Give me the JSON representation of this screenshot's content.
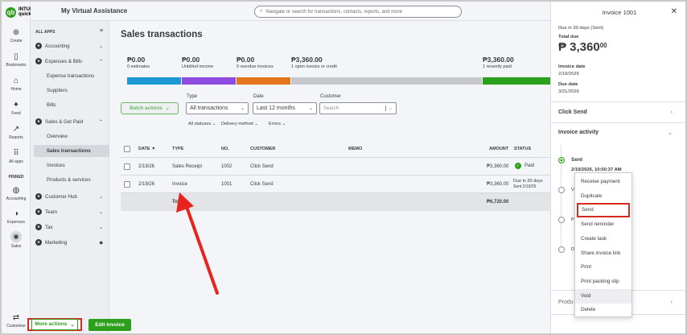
{
  "app": {
    "logo_brand": "INTUIT",
    "logo_name": "quickbooks",
    "company": "My Virtual Assistance"
  },
  "search": {
    "placeholder": "Navigate or search for transactions, contacts, reports, and more"
  },
  "rail": [
    {
      "label": "Create",
      "icon": "plus-icon"
    },
    {
      "label": "Bookmarks",
      "icon": "bookmark-icon"
    },
    {
      "label": "Home",
      "icon": "home-icon"
    },
    {
      "label": "Feed",
      "icon": "feed-icon"
    },
    {
      "label": "Reports",
      "icon": "reports-icon"
    },
    {
      "label": "All apps",
      "icon": "grid-icon"
    },
    {
      "label": "PINNED",
      "icon": ""
    },
    {
      "label": "Accounting",
      "icon": "accounting-icon"
    },
    {
      "label": "Expenses",
      "icon": "expenses-icon"
    },
    {
      "label": "Sales",
      "icon": "sales-icon"
    },
    {
      "label": "Customise",
      "icon": "customise-icon"
    }
  ],
  "appmenu": {
    "heading": "ALL APPS",
    "accounting": "Accounting",
    "expenses_bills": "Expenses & Bills",
    "expense_transactions": "Expense transactions",
    "suppliers": "Suppliers",
    "bills": "Bills",
    "sales_get_paid": "Sales & Get Paid",
    "overview": "Overview",
    "sales_transactions": "Sales transactions",
    "invoices": "Invoices",
    "products_services": "Products & services",
    "customer_hub": "Customer Hub",
    "team": "Team",
    "tax": "Tax",
    "marketing": "Marketing"
  },
  "main": {
    "title": "Sales transactions",
    "stats": [
      {
        "amount": "₱0.00",
        "label": "0 estimates"
      },
      {
        "amount": "₱0.00",
        "label": "Unbilled income"
      },
      {
        "amount": "₱0.00",
        "label": "0 overdue invoices"
      },
      {
        "amount": "₱3,360.00",
        "label": "1 open invoice or credit"
      },
      {
        "amount": "₱3,360.00",
        "label": "1 recently paid"
      }
    ],
    "bar_colors": [
      "#1d9ad6",
      "#8d4be0",
      "#e3761a",
      "#c6c8cc",
      "#2ca01c"
    ],
    "batch_actions": "Batch actions",
    "filters": {
      "type_label": "Type",
      "type_value": "All transactions",
      "date_label": "Date",
      "date_value": "Last 12 months",
      "customer_label": "Customer",
      "customer_placeholder": "Search",
      "statuses": "All statuses",
      "delivery": "Delivery method",
      "errors": "Errors"
    },
    "columns": {
      "date": "DATE ▼",
      "type": "TYPE",
      "no": "NO.",
      "customer": "CUSTOMER",
      "memo": "MEMO",
      "amount": "AMOUNT",
      "status": "STATUS"
    },
    "rows": [
      {
        "date": "2/19/26",
        "type": "Sales Receipt",
        "no": "1002",
        "customer": "Click Send",
        "amount": "₱3,360.00",
        "status": "Paid",
        "status2": ""
      },
      {
        "date": "2/19/26",
        "type": "Invoice",
        "no": "1001",
        "customer": "Click Send",
        "amount": "₱3,360.00",
        "status": "Due in 30 days",
        "status2": "Sent 2/19/26"
      }
    ],
    "total_label": "Total",
    "total_amount": "₱6,720.00"
  },
  "panel": {
    "title": "Invoice 1001",
    "due_status": "Due in 30 days (Sent)",
    "total_due_label": "Total due",
    "total_due_main": "₱ 3,360",
    "total_due_cents": "00",
    "invoice_date_label": "Invoice date",
    "invoice_date": "2/19/2026",
    "due_date_label": "Due date",
    "due_date": "3/21/2026",
    "click_send": "Click Send",
    "activity": "Invoice activity",
    "sent": "Sent",
    "sent_time": "2/19/2026, 10:50:37 AM",
    "partial_v": "Vi",
    "partial_p": "P",
    "partial_d": "De",
    "partial_product": "Produ",
    "more_actions": "More actions",
    "edit_invoice": "Edit invoice"
  },
  "dropdown": [
    "Receive payment",
    "Duplicate",
    "Send",
    "Send reminder",
    "Create task",
    "Share invoice link",
    "Print",
    "Print packing slip",
    "Void",
    "Delete"
  ]
}
